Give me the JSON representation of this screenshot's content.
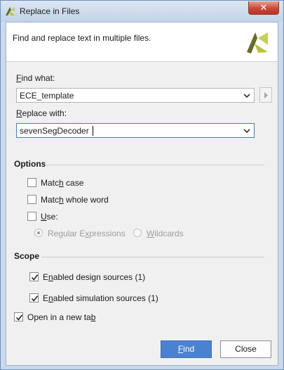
{
  "window": {
    "title": "Replace in Files",
    "close_glyph": "✕"
  },
  "header": {
    "description": "Find and replace text in multiple files."
  },
  "find": {
    "label_mnemonic": "F",
    "label_rest": "ind what:",
    "value": "ECE_template"
  },
  "replace": {
    "label_mnemonic": "R",
    "label_rest": "eplace with:",
    "value": "sevenSegDecoder"
  },
  "options": {
    "title": "Options",
    "match_case": {
      "pre": "Matc",
      "mn": "h",
      "post": " case",
      "checked": false
    },
    "match_whole_word": {
      "pre": "Matc",
      "mn": "h",
      "post": " whole word",
      "checked": false
    },
    "use": {
      "pre": "",
      "mn": "U",
      "post": "se:",
      "checked": false
    },
    "regex": {
      "pre": "Regular E",
      "mn": "x",
      "post": "pressions",
      "selected": true,
      "enabled": false
    },
    "wildcards": {
      "pre": "",
      "mn": "W",
      "post": "ildcards",
      "selected": false,
      "enabled": false
    }
  },
  "scope": {
    "title": "Scope",
    "design_sources": {
      "pre": "E",
      "mn": "n",
      "post": "abled design sources (1)",
      "checked": true
    },
    "simulation_sources": {
      "pre": "E",
      "mn": "n",
      "post": "abled simulation sources (1)",
      "checked": true
    }
  },
  "open_new_tab": {
    "pre": "Open in a new ta",
    "mn": "b",
    "post": "",
    "checked": true
  },
  "buttons": {
    "find": {
      "pre": "",
      "mn": "F",
      "post": "ind"
    },
    "close": "Close"
  },
  "colors": {
    "primary_button": "#4b82d0",
    "focus_border": "#4a79c4",
    "logo_dark": "#6a6a2c",
    "logo_light": "#b9c23a"
  },
  "icons": {
    "app": "vivado-logo-icon",
    "header_logo": "vivado-logo-icon",
    "dropdown": "chevron-down-icon",
    "side": "chevron-right-icon",
    "checkbox_mark": "checkmark-icon"
  }
}
